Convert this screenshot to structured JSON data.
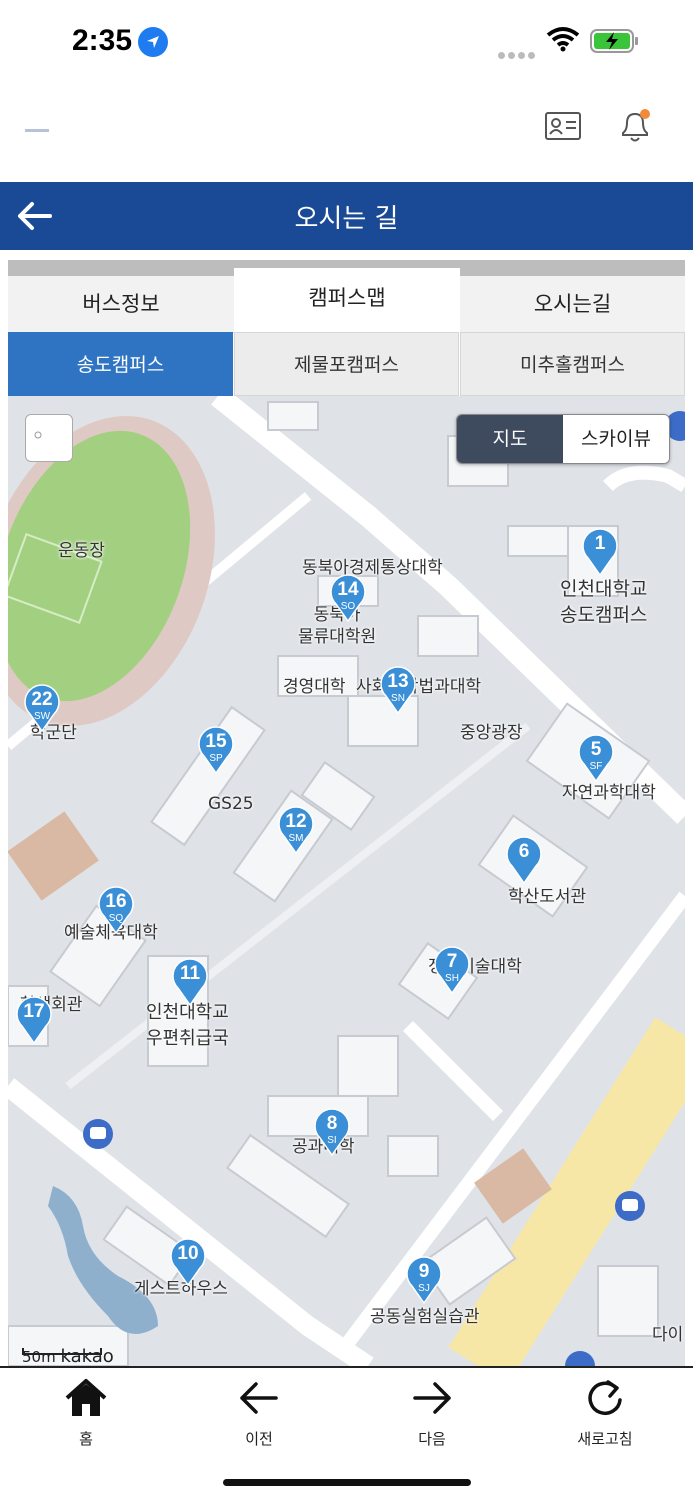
{
  "status": {
    "time": "2:35"
  },
  "header": {
    "title": "오시는 길"
  },
  "tabs": [
    {
      "label": "버스정보"
    },
    {
      "label": "캠퍼스맵"
    },
    {
      "label": "오시는길"
    }
  ],
  "campus_tabs": [
    {
      "label": "송도캠퍼스"
    },
    {
      "label": "제물포캠퍼스"
    },
    {
      "label": "미추홀캠퍼스"
    }
  ],
  "map": {
    "toggle": {
      "map": "지도",
      "sky": "스카이뷰"
    },
    "places": {
      "stadium": "운동장",
      "neea": "동북아경제통상대학",
      "logistics": "동북아\n물류대학원",
      "univ": "인천대학교\n송도캠퍼스",
      "biz": "경영대학",
      "social": "사회과학법과대학",
      "plaza": "중앙광장",
      "science": "자연과학대학",
      "rotc": "학군단",
      "gs25": "GS25",
      "library": "학산도서관",
      "arts": "예술체육대학",
      "infotech": "정보기술대학",
      "stuhall": "학생회관",
      "post": "인천대학교\n우편취급국",
      "eng": "공과대학",
      "guest": "게스트하우스",
      "lab": "공동실험실습관",
      "daily": "다이"
    },
    "pins": [
      {
        "num": "1",
        "code": ""
      },
      {
        "num": "14",
        "code": "SO"
      },
      {
        "num": "13",
        "code": "SN"
      },
      {
        "num": "22",
        "code": "SW"
      },
      {
        "num": "15",
        "code": "SP"
      },
      {
        "num": "5",
        "code": "SF"
      },
      {
        "num": "12",
        "code": "SM"
      },
      {
        "num": "6",
        "code": ""
      },
      {
        "num": "16",
        "code": "SQ"
      },
      {
        "num": "7",
        "code": "SH"
      },
      {
        "num": "11",
        "code": ""
      },
      {
        "num": "17",
        "code": ""
      },
      {
        "num": "8",
        "code": "SI"
      },
      {
        "num": "10",
        "code": ""
      },
      {
        "num": "9",
        "code": "SJ"
      }
    ],
    "scale": "50m",
    "provider": "kakao"
  },
  "bottom_nav": [
    {
      "label": "홈"
    },
    {
      "label": "이전"
    },
    {
      "label": "다음"
    },
    {
      "label": "새로고침"
    }
  ]
}
